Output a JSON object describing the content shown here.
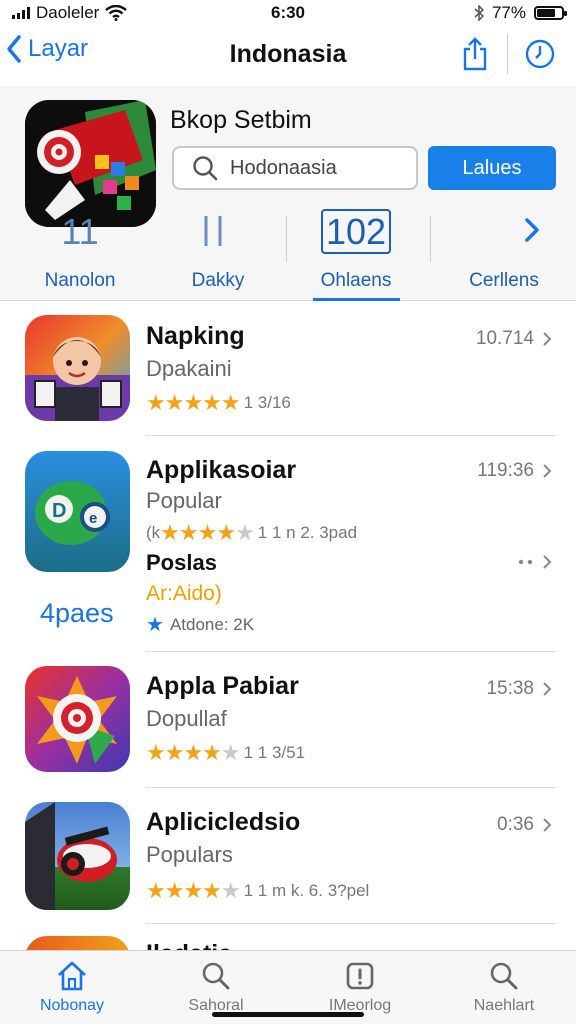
{
  "status_bar": {
    "carrier": "Daoleler",
    "time": "6:30",
    "battery": "77%",
    "battery_level": 0.77
  },
  "nav": {
    "back_label": "Layar",
    "title": "Indonasia"
  },
  "header": {
    "store_title": "Bkop Setbim",
    "search_value": "Hodonaasia",
    "search_button": "Lalues",
    "stats": [
      {
        "num": "11",
        "label": "Nanolon"
      },
      {
        "num": "",
        "label": "Dakky"
      },
      {
        "num": "102",
        "label": "Ohlaens"
      },
      {
        "num": "",
        "label": "Cerllens"
      }
    ]
  },
  "apps": [
    {
      "name": "Napking",
      "category": "Dpakaini",
      "meta": "10.714",
      "stars": 5,
      "count": "1 3/16"
    },
    {
      "name": "Applikasoiar",
      "category": "Popular",
      "meta": "119:36",
      "prefix": "(k",
      "stars": 4.5,
      "count": "1 1 n  2. 3pad",
      "sub": {
        "name": "Poslas",
        "badge": "Ar:Aido)",
        "meta": "Atdone: 2K",
        "promo": "4paes"
      }
    },
    {
      "name": "Appla Pabiar",
      "category": "Dopullaf",
      "meta": "15:38",
      "stars": 4,
      "count": "1 1 3/51"
    },
    {
      "name": "Aplicicledsio",
      "category": "Populars",
      "meta": "0:36",
      "stars": 4,
      "count": "1 1 m  k. 6. 3?pel"
    },
    {
      "name": "Iladatia",
      "category": "",
      "meta": ""
    }
  ],
  "tabs": [
    {
      "label": "Nobonay",
      "icon": "home-icon",
      "active": true
    },
    {
      "label": "Sahoral",
      "icon": "search-icon",
      "active": false
    },
    {
      "label": "IMeorlog",
      "icon": "info-box-icon",
      "active": false
    },
    {
      "label": "Naehlart",
      "icon": "search-icon",
      "active": false
    }
  ],
  "colors": {
    "accent": "#1a74e4",
    "star": "#f3a21a",
    "badge": "#e8a200"
  }
}
